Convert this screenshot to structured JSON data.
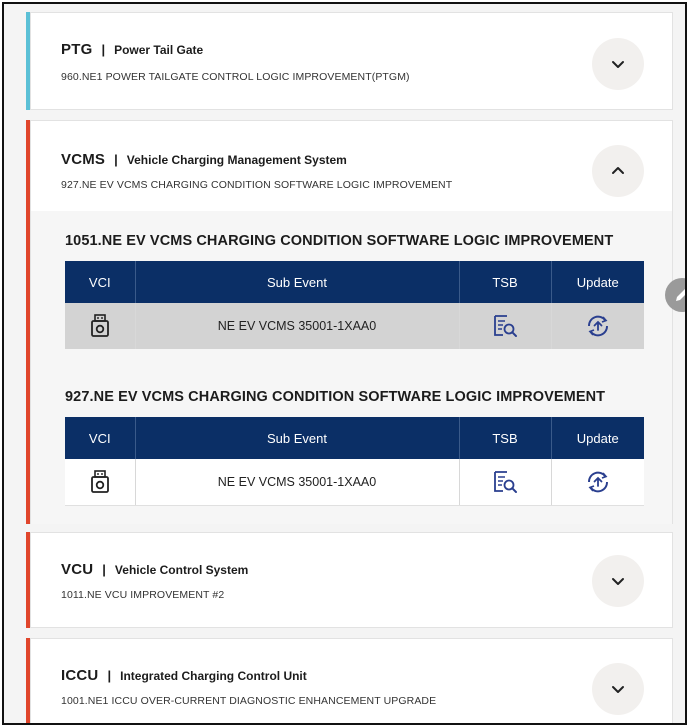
{
  "colors": {
    "ptg_bar": "#5bc0d6",
    "active_bar": "#e0452b",
    "table_header": "#0b2f66"
  },
  "cards": {
    "ptg": {
      "code": "PTG",
      "separator": "|",
      "name": "Power Tail Gate",
      "description": "960.NE1 POWER TAILGATE CONTROL LOGIC IMPROVEMENT(PTGM)",
      "toggle_icon": "chevron-down-icon"
    },
    "vcms": {
      "code": "VCMS",
      "separator": "|",
      "name": "Vehicle Charging Management System",
      "description": "927.NE EV VCMS CHARGING CONDITION SOFTWARE LOGIC IMPROVEMENT",
      "toggle_icon": "chevron-up-icon",
      "sections": [
        {
          "title": "1051.NE EV VCMS CHARGING CONDITION SOFTWARE LOGIC IMPROVEMENT",
          "headers": [
            "VCI",
            "Sub Event",
            "TSB",
            "Update"
          ],
          "row": {
            "vci_icon": "vci-device-icon",
            "sub_event": "NE EV VCMS 35001-1XAA0",
            "tsb_icon": "tsb-document-search-icon",
            "update_icon": "update-refresh-icon"
          }
        },
        {
          "title": "927.NE EV VCMS CHARGING CONDITION SOFTWARE LOGIC IMPROVEMENT",
          "headers": [
            "VCI",
            "Sub Event",
            "TSB",
            "Update"
          ],
          "row": {
            "vci_icon": "vci-device-icon",
            "sub_event": "NE EV VCMS 35001-1XAA0",
            "tsb_icon": "tsb-document-search-icon",
            "update_icon": "update-refresh-icon"
          }
        }
      ]
    },
    "vcu": {
      "code": "VCU",
      "separator": "|",
      "name": "Vehicle Control System",
      "description": "1011.NE VCU IMPROVEMENT #2",
      "toggle_icon": "chevron-down-icon"
    },
    "iccu": {
      "code": "ICCU",
      "separator": "|",
      "name": "Integrated Charging Control Unit",
      "description": "1001.NE1 ICCU OVER-CURRENT DIAGNOSTIC ENHANCEMENT UPGRADE",
      "toggle_icon": "chevron-down-icon"
    }
  },
  "floating_edit_icon": "pencil-icon"
}
